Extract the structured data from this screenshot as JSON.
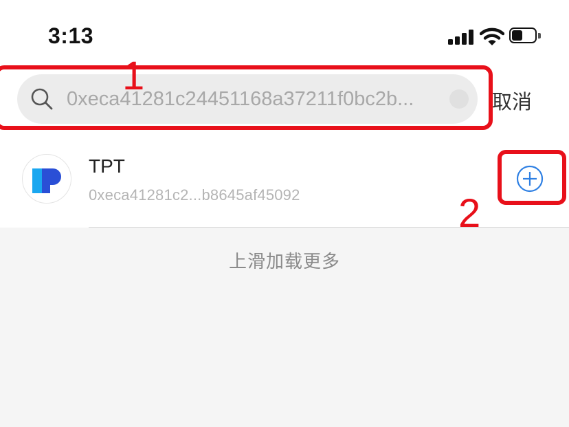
{
  "status_bar": {
    "time": "3:13",
    "icons": [
      "cellular-signal-icon",
      "wifi-icon",
      "battery-icon"
    ]
  },
  "search": {
    "value": "0xeca41281c24451168a37211f0bc2b...",
    "icon": "search-icon",
    "clear_icon": "clear-icon"
  },
  "cancel_label": "取消",
  "results": [
    {
      "name": "TPT",
      "address": "0xeca41281c2...b8645af45092",
      "logo_icon": "tpt-logo",
      "action_icon": "plus-circle-icon"
    }
  ],
  "load_more_label": "上滑加载更多",
  "annotations": [
    {
      "number": "1",
      "target": "search-box"
    },
    {
      "number": "2",
      "target": "add-token-button"
    }
  ],
  "colors": {
    "annotation_red": "#e8101a",
    "accent_blue": "#2f80e3",
    "logo_cyan": "#1aa7f0",
    "logo_blue": "#2a4fd6",
    "search_bg": "#ececec",
    "page_bg": "#f5f5f5"
  }
}
